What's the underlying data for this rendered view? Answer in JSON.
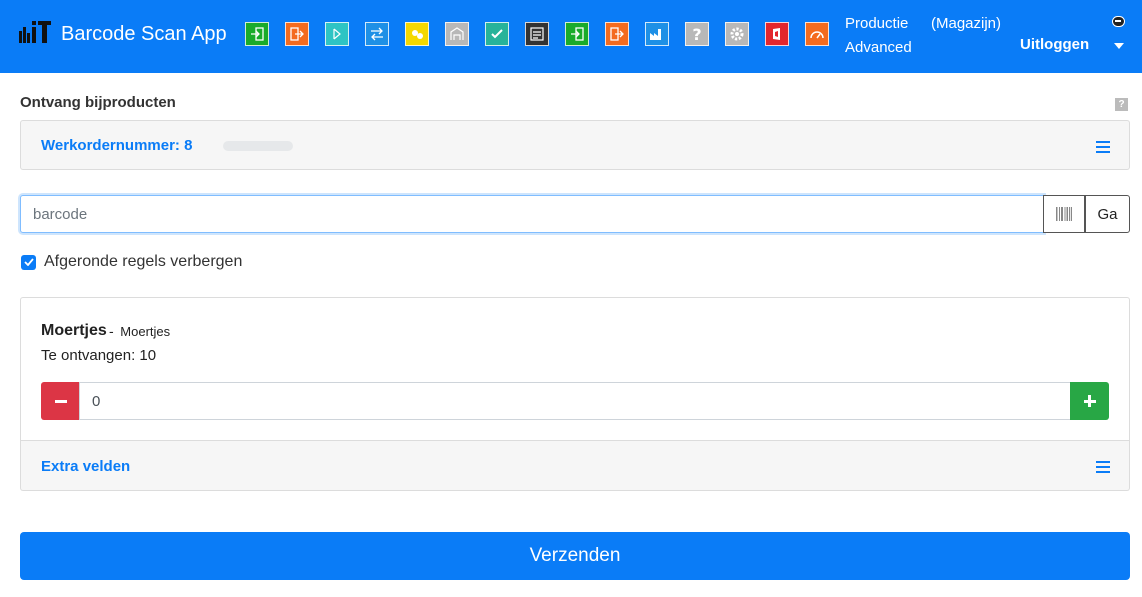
{
  "header": {
    "app_title": "Barcode Scan App",
    "logo_text": "iT",
    "user_line1": "Productie",
    "user_line2": "Advanced",
    "warehouse": "(Magazijn)",
    "logout_label": "Uitloggen"
  },
  "toolbar": {
    "icons": [
      {
        "name": "receive-icon",
        "color": "#1aab2b"
      },
      {
        "name": "issue-icon",
        "color": "#f46b1e"
      },
      {
        "name": "pick-icon",
        "color": "#2ec4c4"
      },
      {
        "name": "transfer-icon",
        "color": "#1e90e6"
      },
      {
        "name": "count-icon",
        "color": "#f5d800"
      },
      {
        "name": "warehouse-icon",
        "color": "#b8b8b8"
      },
      {
        "name": "check-icon",
        "color": "#27b39a"
      },
      {
        "name": "list-icon",
        "color": "#333333"
      },
      {
        "name": "production-receive-icon",
        "color": "#1aab2b"
      },
      {
        "name": "production-issue-icon",
        "color": "#f46b1e"
      },
      {
        "name": "factory-icon",
        "color": "#1e90e6"
      },
      {
        "name": "help-icon",
        "color": "#b8b8b8"
      },
      {
        "name": "settings-icon",
        "color": "#b8b8b8"
      },
      {
        "name": "office-icon",
        "color": "#e3262d"
      },
      {
        "name": "gauge-icon",
        "color": "#f46b1e"
      }
    ],
    "help_glyph": "?"
  },
  "page": {
    "title": "Ontvang bijproducten",
    "help_glyph": "?"
  },
  "work_order": {
    "label": "Werkordernummer: 8"
  },
  "barcode": {
    "placeholder": "barcode",
    "go_label": "Ga"
  },
  "options": {
    "hide_completed_label": "Afgeronde regels verbergen",
    "hide_completed_checked": true
  },
  "product": {
    "name": "Moertjes",
    "dash": "-",
    "description": "Moertjes",
    "to_receive": "Te ontvangen: 10",
    "quantity": "0"
  },
  "extra_fields": {
    "label": "Extra velden"
  },
  "submit": {
    "label": "Verzenden"
  },
  "colors": {
    "primary": "#0a7cf7",
    "danger": "#dc3545",
    "success": "#28a745"
  }
}
